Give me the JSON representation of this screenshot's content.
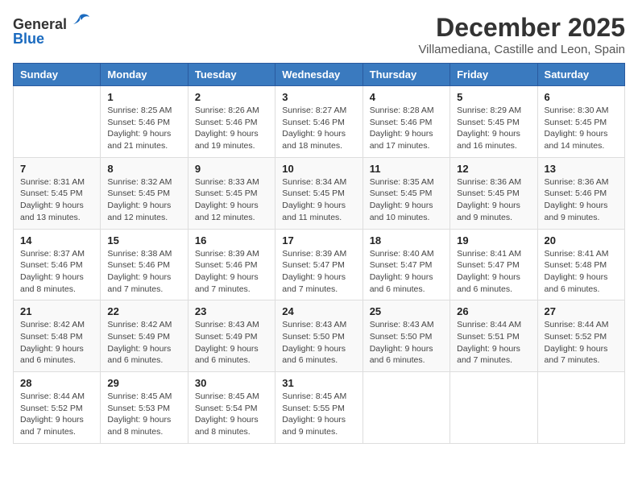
{
  "logo": {
    "general": "General",
    "blue": "Blue"
  },
  "title": "December 2025",
  "location": "Villamediana, Castille and Leon, Spain",
  "weekdays": [
    "Sunday",
    "Monday",
    "Tuesday",
    "Wednesday",
    "Thursday",
    "Friday",
    "Saturday"
  ],
  "weeks": [
    [
      {
        "day": "",
        "info": ""
      },
      {
        "day": "1",
        "info": "Sunrise: 8:25 AM\nSunset: 5:46 PM\nDaylight: 9 hours\nand 21 minutes."
      },
      {
        "day": "2",
        "info": "Sunrise: 8:26 AM\nSunset: 5:46 PM\nDaylight: 9 hours\nand 19 minutes."
      },
      {
        "day": "3",
        "info": "Sunrise: 8:27 AM\nSunset: 5:46 PM\nDaylight: 9 hours\nand 18 minutes."
      },
      {
        "day": "4",
        "info": "Sunrise: 8:28 AM\nSunset: 5:46 PM\nDaylight: 9 hours\nand 17 minutes."
      },
      {
        "day": "5",
        "info": "Sunrise: 8:29 AM\nSunset: 5:45 PM\nDaylight: 9 hours\nand 16 minutes."
      },
      {
        "day": "6",
        "info": "Sunrise: 8:30 AM\nSunset: 5:45 PM\nDaylight: 9 hours\nand 14 minutes."
      }
    ],
    [
      {
        "day": "7",
        "info": "Sunrise: 8:31 AM\nSunset: 5:45 PM\nDaylight: 9 hours\nand 13 minutes."
      },
      {
        "day": "8",
        "info": "Sunrise: 8:32 AM\nSunset: 5:45 PM\nDaylight: 9 hours\nand 12 minutes."
      },
      {
        "day": "9",
        "info": "Sunrise: 8:33 AM\nSunset: 5:45 PM\nDaylight: 9 hours\nand 12 minutes."
      },
      {
        "day": "10",
        "info": "Sunrise: 8:34 AM\nSunset: 5:45 PM\nDaylight: 9 hours\nand 11 minutes."
      },
      {
        "day": "11",
        "info": "Sunrise: 8:35 AM\nSunset: 5:45 PM\nDaylight: 9 hours\nand 10 minutes."
      },
      {
        "day": "12",
        "info": "Sunrise: 8:36 AM\nSunset: 5:45 PM\nDaylight: 9 hours\nand 9 minutes."
      },
      {
        "day": "13",
        "info": "Sunrise: 8:36 AM\nSunset: 5:46 PM\nDaylight: 9 hours\nand 9 minutes."
      }
    ],
    [
      {
        "day": "14",
        "info": "Sunrise: 8:37 AM\nSunset: 5:46 PM\nDaylight: 9 hours\nand 8 minutes."
      },
      {
        "day": "15",
        "info": "Sunrise: 8:38 AM\nSunset: 5:46 PM\nDaylight: 9 hours\nand 7 minutes."
      },
      {
        "day": "16",
        "info": "Sunrise: 8:39 AM\nSunset: 5:46 PM\nDaylight: 9 hours\nand 7 minutes."
      },
      {
        "day": "17",
        "info": "Sunrise: 8:39 AM\nSunset: 5:47 PM\nDaylight: 9 hours\nand 7 minutes."
      },
      {
        "day": "18",
        "info": "Sunrise: 8:40 AM\nSunset: 5:47 PM\nDaylight: 9 hours\nand 6 minutes."
      },
      {
        "day": "19",
        "info": "Sunrise: 8:41 AM\nSunset: 5:47 PM\nDaylight: 9 hours\nand 6 minutes."
      },
      {
        "day": "20",
        "info": "Sunrise: 8:41 AM\nSunset: 5:48 PM\nDaylight: 9 hours\nand 6 minutes."
      }
    ],
    [
      {
        "day": "21",
        "info": "Sunrise: 8:42 AM\nSunset: 5:48 PM\nDaylight: 9 hours\nand 6 minutes."
      },
      {
        "day": "22",
        "info": "Sunrise: 8:42 AM\nSunset: 5:49 PM\nDaylight: 9 hours\nand 6 minutes."
      },
      {
        "day": "23",
        "info": "Sunrise: 8:43 AM\nSunset: 5:49 PM\nDaylight: 9 hours\nand 6 minutes."
      },
      {
        "day": "24",
        "info": "Sunrise: 8:43 AM\nSunset: 5:50 PM\nDaylight: 9 hours\nand 6 minutes."
      },
      {
        "day": "25",
        "info": "Sunrise: 8:43 AM\nSunset: 5:50 PM\nDaylight: 9 hours\nand 6 minutes."
      },
      {
        "day": "26",
        "info": "Sunrise: 8:44 AM\nSunset: 5:51 PM\nDaylight: 9 hours\nand 7 minutes."
      },
      {
        "day": "27",
        "info": "Sunrise: 8:44 AM\nSunset: 5:52 PM\nDaylight: 9 hours\nand 7 minutes."
      }
    ],
    [
      {
        "day": "28",
        "info": "Sunrise: 8:44 AM\nSunset: 5:52 PM\nDaylight: 9 hours\nand 7 minutes."
      },
      {
        "day": "29",
        "info": "Sunrise: 8:45 AM\nSunset: 5:53 PM\nDaylight: 9 hours\nand 8 minutes."
      },
      {
        "day": "30",
        "info": "Sunrise: 8:45 AM\nSunset: 5:54 PM\nDaylight: 9 hours\nand 8 minutes."
      },
      {
        "day": "31",
        "info": "Sunrise: 8:45 AM\nSunset: 5:55 PM\nDaylight: 9 hours\nand 9 minutes."
      },
      {
        "day": "",
        "info": ""
      },
      {
        "day": "",
        "info": ""
      },
      {
        "day": "",
        "info": ""
      }
    ]
  ]
}
